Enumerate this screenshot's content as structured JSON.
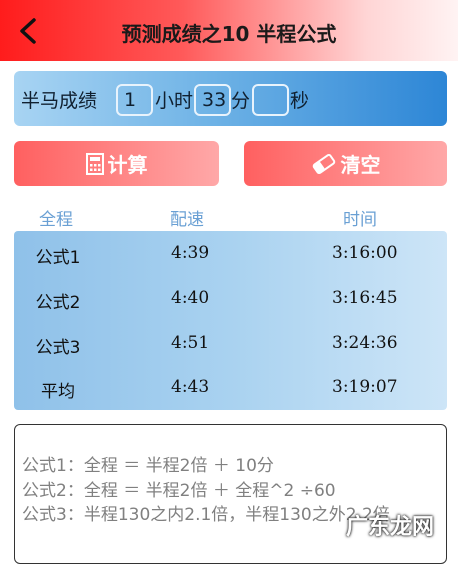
{
  "header": {
    "title": "预测成绩之10 半程公式"
  },
  "input": {
    "label": "半马成绩",
    "hours": "1",
    "hours_unit": "小时",
    "minutes": "33",
    "minutes_unit": "分",
    "seconds": "",
    "seconds_unit": "秒"
  },
  "buttons": {
    "calc": "计算",
    "clear": "清空"
  },
  "table": {
    "headers": [
      "全程",
      "配速",
      "时间"
    ],
    "rows": [
      {
        "name": "公式1",
        "pace": "4:39",
        "time": "3:16:00"
      },
      {
        "name": "公式2",
        "pace": "4:40",
        "time": "3:16:45"
      },
      {
        "name": "公式3",
        "pace": "4:51",
        "time": "3:24:36"
      },
      {
        "name": "平均",
        "pace": "4:43",
        "time": "3:19:07"
      }
    ]
  },
  "formulas": [
    "公式1：全程 ＝ 半程2倍 ＋ 10分",
    "公式2：全程 ＝ 半程2倍 ＋ 全程^2 ÷60",
    "公式3：半程130之内2.1倍，半程130之外2.2倍"
  ],
  "watermark": "广东龙网",
  "colors": {
    "header_red": "#ff1c1c",
    "bar_blue": "#2d86d6",
    "button_red": "#ff6060"
  }
}
